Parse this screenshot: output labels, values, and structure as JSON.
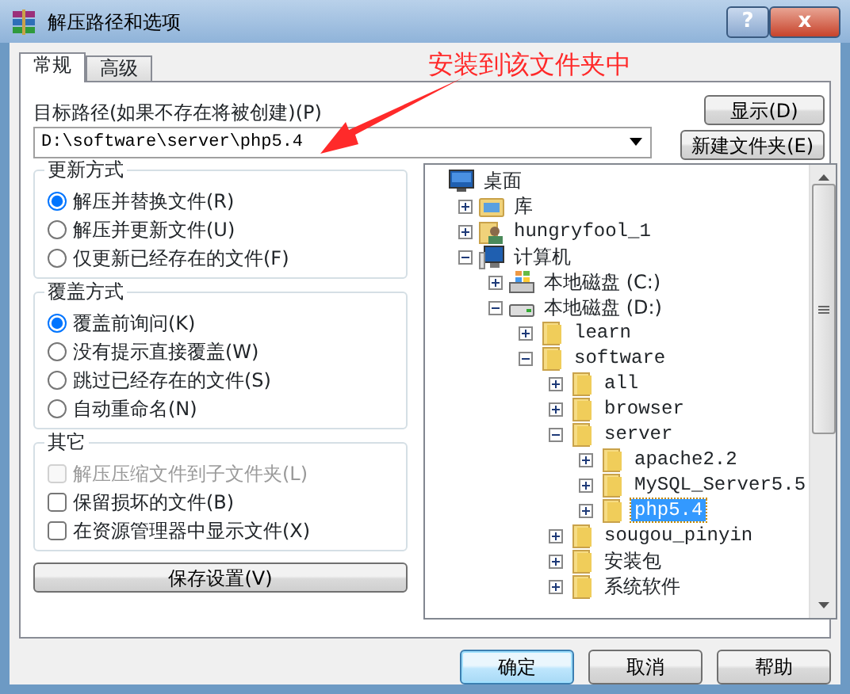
{
  "window": {
    "title": "解压路径和选项",
    "buttons": [
      {
        "kind": "help",
        "glyph": "?"
      },
      {
        "kind": "close",
        "glyph": "x"
      }
    ]
  },
  "tabs": [
    {
      "label": "常规",
      "selected": true
    },
    {
      "label": "高级",
      "selected": false
    }
  ],
  "annotation": {
    "text": "安装到该文件夹中"
  },
  "destination": {
    "label": "目标路径(如果不存在将被创建)(P)",
    "value": "D:\\software\\server\\php5.4"
  },
  "side_buttons": [
    "显示(D)",
    "新建文件夹(E)"
  ],
  "groups": [
    {
      "title": "更新方式",
      "kind": "radio",
      "options": [
        {
          "label": "解压并替换文件(R)",
          "selected": true
        },
        {
          "label": "解压并更新文件(U)",
          "selected": false
        },
        {
          "label": "仅更新已经存在的文件(F)",
          "selected": false
        }
      ]
    },
    {
      "title": "覆盖方式",
      "kind": "radio",
      "options": [
        {
          "label": "覆盖前询问(K)",
          "selected": true
        },
        {
          "label": "没有提示直接覆盖(W)",
          "selected": false
        },
        {
          "label": "跳过已经存在的文件(S)",
          "selected": false
        },
        {
          "label": "自动重命名(N)",
          "selected": false
        }
      ]
    },
    {
      "title": "其它",
      "kind": "check",
      "options": [
        {
          "label": "解压压缩文件到子文件夹(L)",
          "checked": false,
          "disabled": true
        },
        {
          "label": "保留损坏的文件(B)",
          "checked": false,
          "disabled": false
        },
        {
          "label": "在资源管理器中显示文件(X)",
          "checked": false,
          "disabled": false
        }
      ]
    }
  ],
  "save_button": "保存设置(V)",
  "tree": [
    {
      "label": "桌面",
      "kind": "desktop",
      "selected": false,
      "children": [
        {
          "label": "库",
          "kind": "library",
          "expanded": false,
          "selected": false
        },
        {
          "label": "hungryfool_1",
          "kind": "user",
          "expanded": false,
          "selected": false
        },
        {
          "label": "计算机",
          "kind": "computer",
          "expanded": true,
          "selected": false,
          "children": [
            {
              "label": "本地磁盘 (C:)",
              "kind": "drive-windows",
              "expanded": false,
              "selected": false
            },
            {
              "label": "本地磁盘 (D:)",
              "kind": "drive",
              "expanded": true,
              "selected": false,
              "children": [
                {
                  "label": "learn",
                  "kind": "folder",
                  "expanded": false,
                  "selected": false
                },
                {
                  "label": "software",
                  "kind": "folder",
                  "expanded": true,
                  "selected": false,
                  "children": [
                    {
                      "label": "all",
                      "kind": "folder",
                      "expanded": false,
                      "selected": false
                    },
                    {
                      "label": "browser",
                      "kind": "folder",
                      "expanded": false,
                      "selected": false
                    },
                    {
                      "label": "server",
                      "kind": "folder",
                      "expanded": true,
                      "selected": false,
                      "children": [
                        {
                          "label": "apache2.2",
                          "kind": "folder",
                          "expanded": false,
                          "selected": false
                        },
                        {
                          "label": "MySQL_Server5.5",
                          "kind": "folder",
                          "expanded": false,
                          "selected": false
                        },
                        {
                          "label": "php5.4",
                          "kind": "folder",
                          "expanded": false,
                          "selected": true
                        }
                      ]
                    },
                    {
                      "label": "sougou_pinyin",
                      "kind": "folder",
                      "expanded": false,
                      "selected": false
                    },
                    {
                      "label": "安装包",
                      "kind": "folder",
                      "expanded": false,
                      "selected": false
                    },
                    {
                      "label": "系统软件",
                      "kind": "folder",
                      "expanded": false,
                      "selected": false
                    }
                  ]
                }
              ]
            }
          ]
        }
      ]
    }
  ],
  "footer_buttons": [
    {
      "label": "确定",
      "default": true
    },
    {
      "label": "取消",
      "default": false
    },
    {
      "label": "帮助",
      "default": false
    }
  ]
}
